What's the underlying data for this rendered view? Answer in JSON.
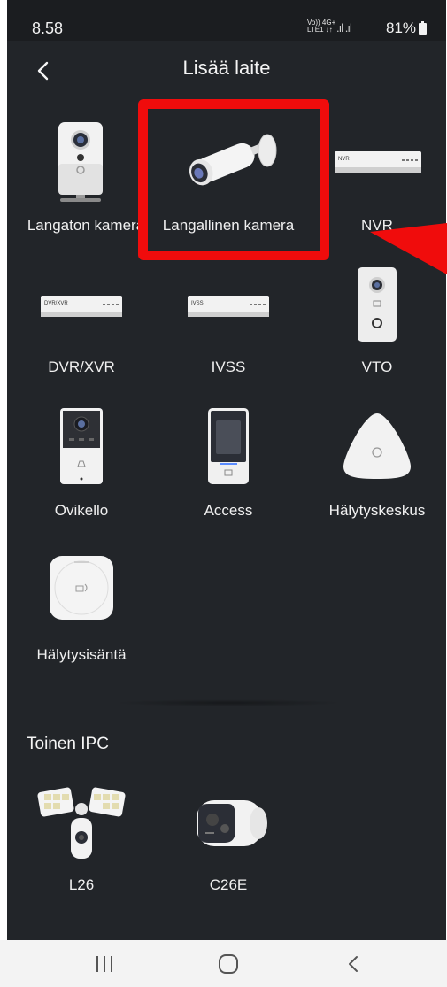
{
  "status": {
    "time": "8.58",
    "network_top": "Vo))  4G+",
    "network_bottom": "LTE1  ↓↑",
    "signal": ".ıl .ıl",
    "battery": "81%"
  },
  "header": {
    "title": "Lisää laite"
  },
  "devices": [
    {
      "label": "Langaton kamera",
      "icon": "wireless-camera-icon"
    },
    {
      "label": "Langallinen kamera",
      "icon": "bullet-camera-icon"
    },
    {
      "label": "NVR",
      "icon": "nvr-recorder-icon",
      "badge": "NVR"
    },
    {
      "label": "DVR/XVR",
      "icon": "dvr-recorder-icon",
      "badge": "DVR/XVR"
    },
    {
      "label": "IVSS",
      "icon": "ivss-recorder-icon",
      "badge": "IVSS"
    },
    {
      "label": "VTO",
      "icon": "vto-intercom-icon"
    },
    {
      "label": "Ovikello",
      "icon": "doorbell-icon"
    },
    {
      "label": "Access",
      "icon": "access-terminal-icon"
    },
    {
      "label": "Hälytyskeskus",
      "icon": "alarm-hub-icon"
    },
    {
      "label": "Hälytysisäntä",
      "icon": "alarm-host-icon"
    }
  ],
  "other_section": {
    "title": "Toinen IPC",
    "devices": [
      {
        "label": "L26",
        "icon": "floodlight-camera-icon"
      },
      {
        "label": "C26E",
        "icon": "c26e-camera-icon"
      }
    ]
  },
  "annotation": {
    "color": "#f00c0c"
  },
  "navbar": {
    "recents": "recents-icon",
    "home": "home-icon",
    "back": "back-icon"
  }
}
